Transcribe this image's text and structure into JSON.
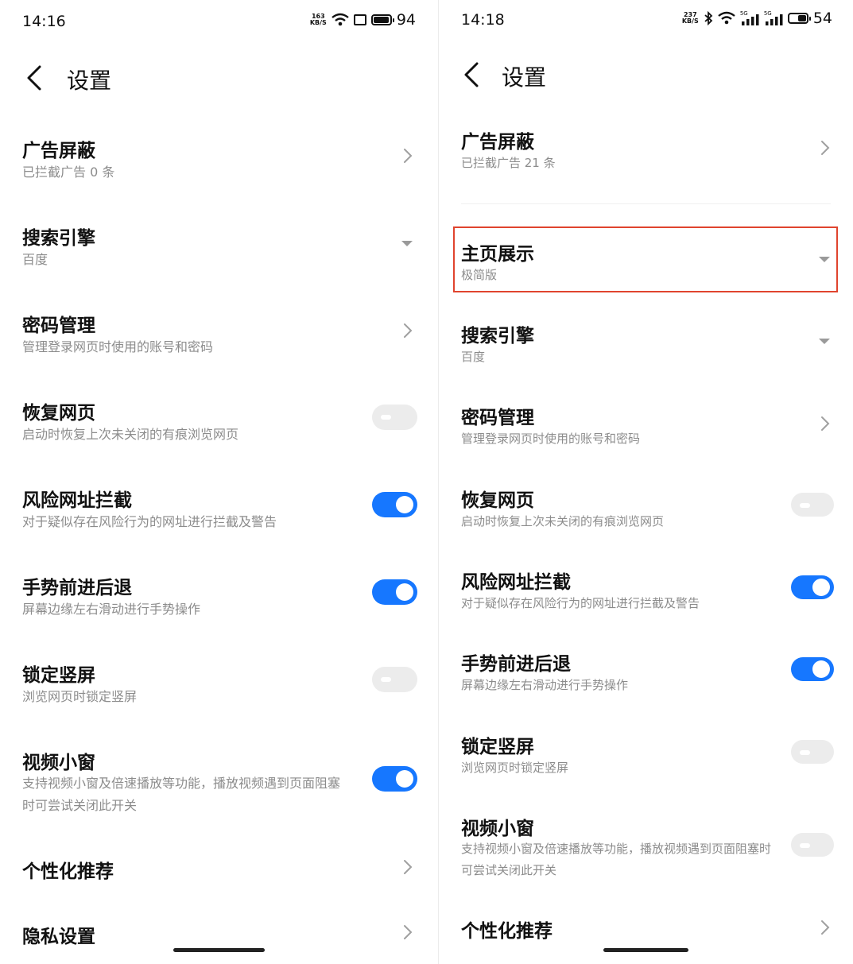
{
  "left": {
    "status": {
      "time": "14:16",
      "speed_top": "163",
      "speed_bottom": "KB/S",
      "battery": "94"
    },
    "title": "设置",
    "items": [
      {
        "title": "广告屏蔽",
        "subtitle": "已拦截广告 0 条",
        "control": "chevron"
      },
      {
        "title": "搜索引擎",
        "subtitle": "百度",
        "control": "dropdown"
      },
      {
        "title": "密码管理",
        "subtitle": "管理登录网页时使用的账号和密码",
        "control": "chevron"
      },
      {
        "title": "恢复网页",
        "subtitle": "启动时恢复上次未关闭的有痕浏览网页",
        "control": "toggle",
        "on": false
      },
      {
        "title": "风险网址拦截",
        "subtitle": "对于疑似存在风险行为的网址进行拦截及警告",
        "control": "toggle",
        "on": true
      },
      {
        "title": "手势前进后退",
        "subtitle": "屏幕边缘左右滑动进行手势操作",
        "control": "toggle",
        "on": true
      },
      {
        "title": "锁定竖屏",
        "subtitle": "浏览网页时锁定竖屏",
        "control": "toggle",
        "on": false
      },
      {
        "title": "视频小窗",
        "subtitle": "支持视频小窗及倍速播放等功能，播放视频遇到页面阻塞时可尝试关闭此开关",
        "control": "toggle",
        "on": true
      },
      {
        "title": "个性化推荐",
        "subtitle": "",
        "control": "chevron"
      },
      {
        "title": "隐私设置",
        "subtitle": "",
        "control": "chevron"
      }
    ]
  },
  "right": {
    "status": {
      "time": "14:18",
      "speed_top": "237",
      "speed_bottom": "KB/S",
      "net1": "5G",
      "net2": "5G",
      "battery": "54"
    },
    "title": "设置",
    "items": [
      {
        "title": "广告屏蔽",
        "subtitle": "已拦截广告 21 条",
        "control": "chevron"
      },
      {
        "title": "主页展示",
        "subtitle": "极简版",
        "control": "dropdown",
        "highlighted": true
      },
      {
        "title": "搜索引擎",
        "subtitle": "百度",
        "control": "dropdown"
      },
      {
        "title": "密码管理",
        "subtitle": "管理登录网页时使用的账号和密码",
        "control": "chevron"
      },
      {
        "title": "恢复网页",
        "subtitle": "启动时恢复上次未关闭的有痕浏览网页",
        "control": "toggle",
        "on": false
      },
      {
        "title": "风险网址拦截",
        "subtitle": "对于疑似存在风险行为的网址进行拦截及警告",
        "control": "toggle",
        "on": true
      },
      {
        "title": "手势前进后退",
        "subtitle": "屏幕边缘左右滑动进行手势操作",
        "control": "toggle",
        "on": true
      },
      {
        "title": "锁定竖屏",
        "subtitle": "浏览网页时锁定竖屏",
        "control": "toggle",
        "on": false
      },
      {
        "title": "视频小窗",
        "subtitle": "支持视频小窗及倍速播放等功能，播放视频遇到页面阻塞时可尝试关闭此开关",
        "control": "toggle",
        "on": false
      },
      {
        "title": "个性化推荐",
        "subtitle": "",
        "control": "chevron"
      }
    ]
  },
  "colors": {
    "toggle_on": "#1677ff",
    "toggle_off": "#ececec",
    "highlight": "#e0442e",
    "subtitle": "#8c8c8c"
  }
}
